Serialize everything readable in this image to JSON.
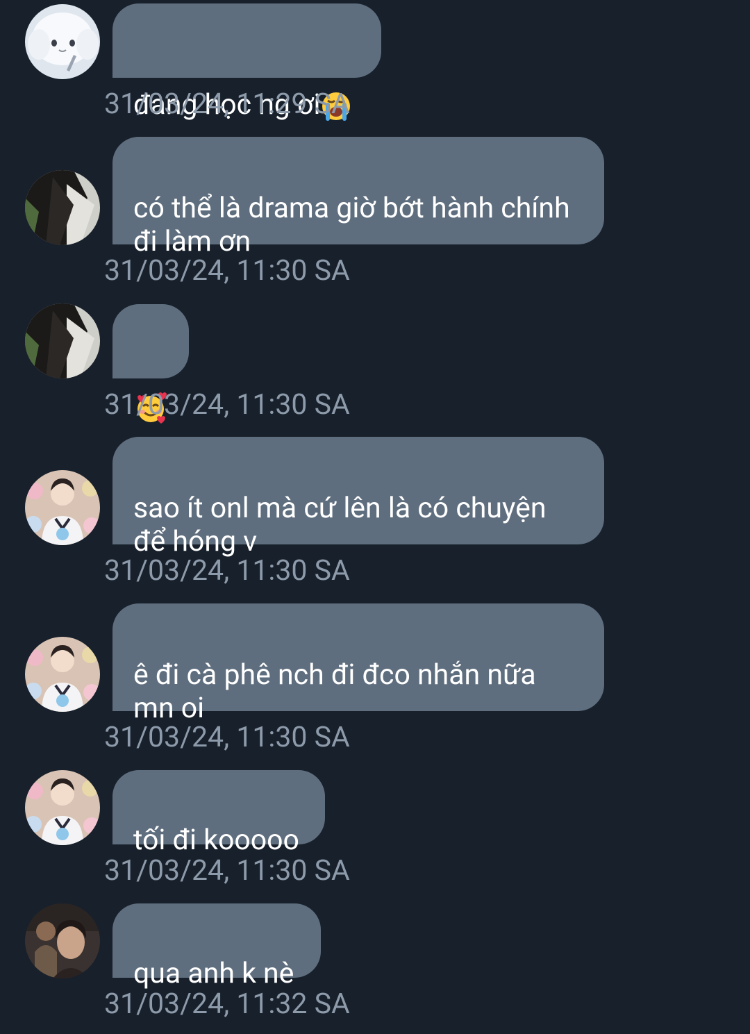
{
  "colors": {
    "background": "#17202b",
    "bubble": "#5f6e7e",
    "text": "#ffffff",
    "timestamp": "#8d9aaa"
  },
  "messages": [
    {
      "avatar": "white-plush-avatar",
      "text": "đang học ng ơi",
      "emoji": "loudly-crying-face-icon",
      "time": "31/03/24, 11:29 SA"
    },
    {
      "avatar": "dark-photo-avatar",
      "text": "có thể là drama giờ bớt hành chính\nđi làm ơn",
      "time": "31/03/24, 11:30 SA"
    },
    {
      "avatar": "dark-photo-avatar",
      "text": "",
      "emoji": "smiling-face-with-hearts-icon",
      "time": "31/03/24, 11:30 SA"
    },
    {
      "avatar": "man-with-plushies-avatar",
      "text": "sao ít onl mà cứ lên là có chuyện\nđể hóng v",
      "time": "31/03/24, 11:30 SA"
    },
    {
      "avatar": "man-with-plushies-avatar",
      "text": "ê đi cà phê nch đi đco nhắn nữa\nmn oi",
      "time": "31/03/24, 11:30 SA"
    },
    {
      "avatar": "man-with-plushies-avatar",
      "text": "tối đi kooooo",
      "time": "31/03/24, 11:30 SA"
    },
    {
      "avatar": "man-portrait-avatar",
      "text": "qua anh k nè",
      "time": "31/03/24, 11:32 SA"
    }
  ]
}
